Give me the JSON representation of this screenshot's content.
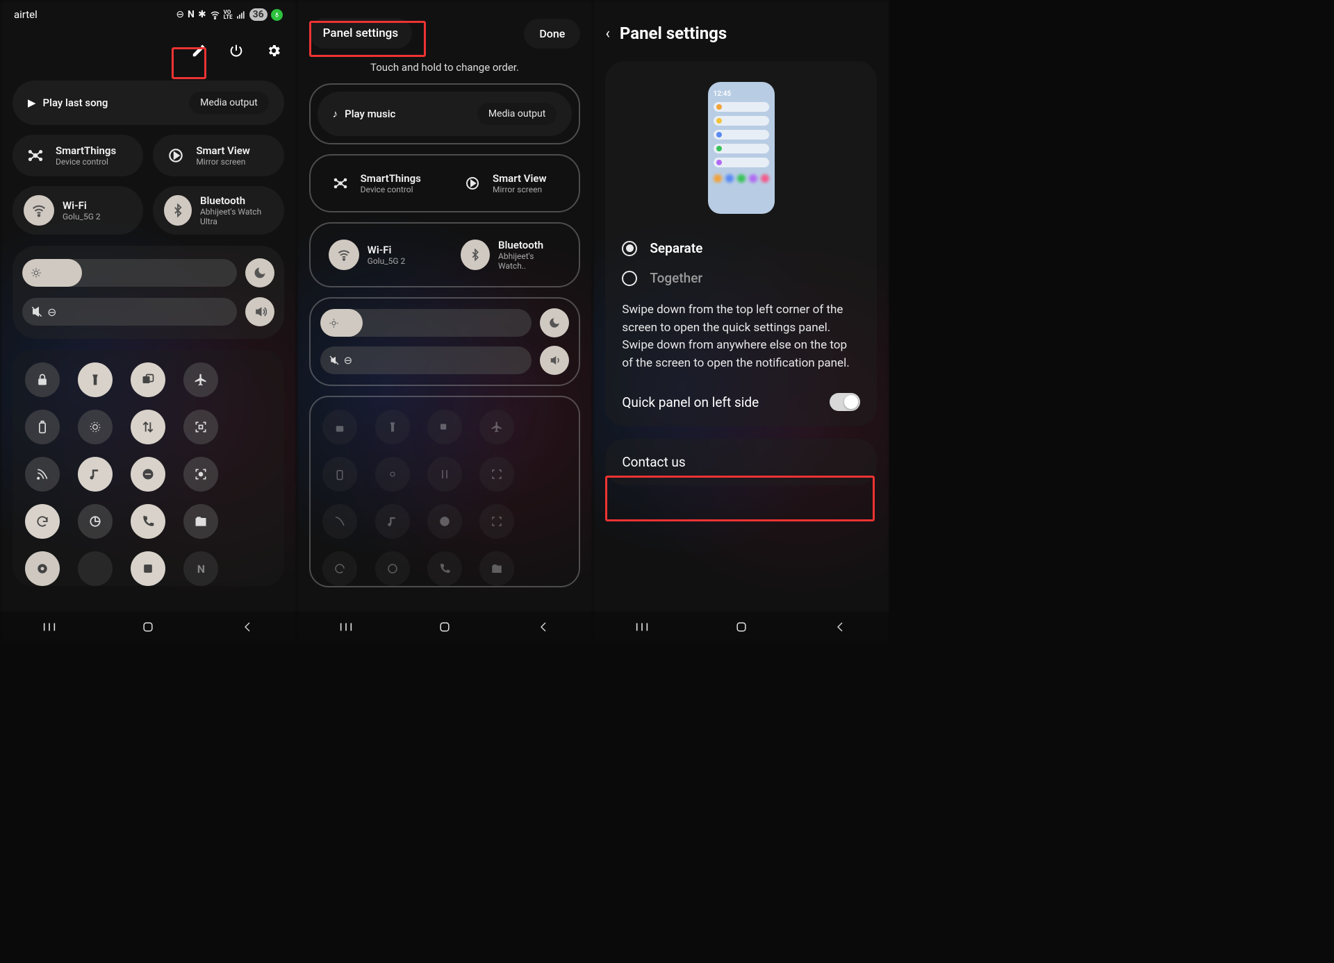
{
  "panel1": {
    "status": {
      "carrier": "airtel",
      "battery": "36"
    },
    "media": {
      "play_last": "Play last song",
      "output": "Media output"
    },
    "smartthings": {
      "title": "SmartThings",
      "sub": "Device control"
    },
    "smartview": {
      "title": "Smart View",
      "sub": "Mirror screen"
    },
    "wifi": {
      "title": "Wi-Fi",
      "sub": "Golu_5G 2"
    },
    "bt": {
      "title": "Bluetooth",
      "sub": "Abhijeet's Watch Ultra"
    }
  },
  "panel2": {
    "panel_settings": "Panel settings",
    "done": "Done",
    "hint": "Touch and hold to change order.",
    "media": {
      "play": "Play music",
      "output": "Media output"
    },
    "smartthings": {
      "title": "SmartThings",
      "sub": "Device control"
    },
    "smartview": {
      "title": "Smart View",
      "sub": "Mirror screen"
    },
    "wifi": {
      "title": "Wi-Fi",
      "sub": "Golu_5G 2"
    },
    "bt": {
      "title": "Bluetooth",
      "sub": "Abhijeet's Watch.."
    }
  },
  "panel3": {
    "title": "Panel settings",
    "preview_time": "12:45",
    "opt_separate": "Separate",
    "opt_together": "Together",
    "desc": "Swipe down from the top left corner of the screen to open the quick settings panel. Swipe down from anywhere else on the top of the screen to open the notification panel.",
    "quick_left": "Quick panel on left side",
    "contact": "Contact us"
  }
}
